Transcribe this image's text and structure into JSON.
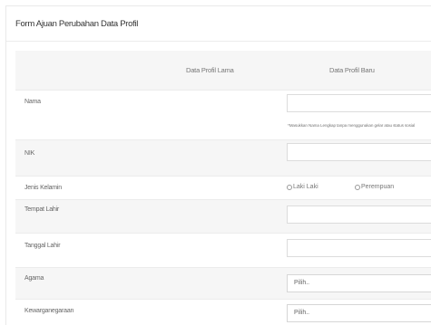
{
  "form": {
    "title": "Form Ajuan Perubahan Data Profil",
    "columns": {
      "old": "Data Profil Lama",
      "new": "Data Profil Baru"
    },
    "fields": {
      "nama": {
        "label": "Nama",
        "value": "",
        "hint": "*Masukkan Nama Lengkap tanpa menggunakan gelar atau status sosial"
      },
      "nik": {
        "label": "NIK",
        "value": ""
      },
      "jenis_kelamin": {
        "label": "Jenis Kelamin",
        "options": [
          "Laki Laki",
          "Perempuan"
        ]
      },
      "tempat_lahir": {
        "label": "Tempat Lahir",
        "value": ""
      },
      "tanggal_lahir": {
        "label": "Tanggal Lahir",
        "value": ""
      },
      "agama": {
        "label": "Agama",
        "selected": "Pilih..",
        "chevron_icon": "chevron-down-icon"
      },
      "kewarganegaraan": {
        "label": "Kewarganegaraan",
        "selected": "Pilih..",
        "chevron_icon": "chevron-down-icon"
      }
    }
  }
}
